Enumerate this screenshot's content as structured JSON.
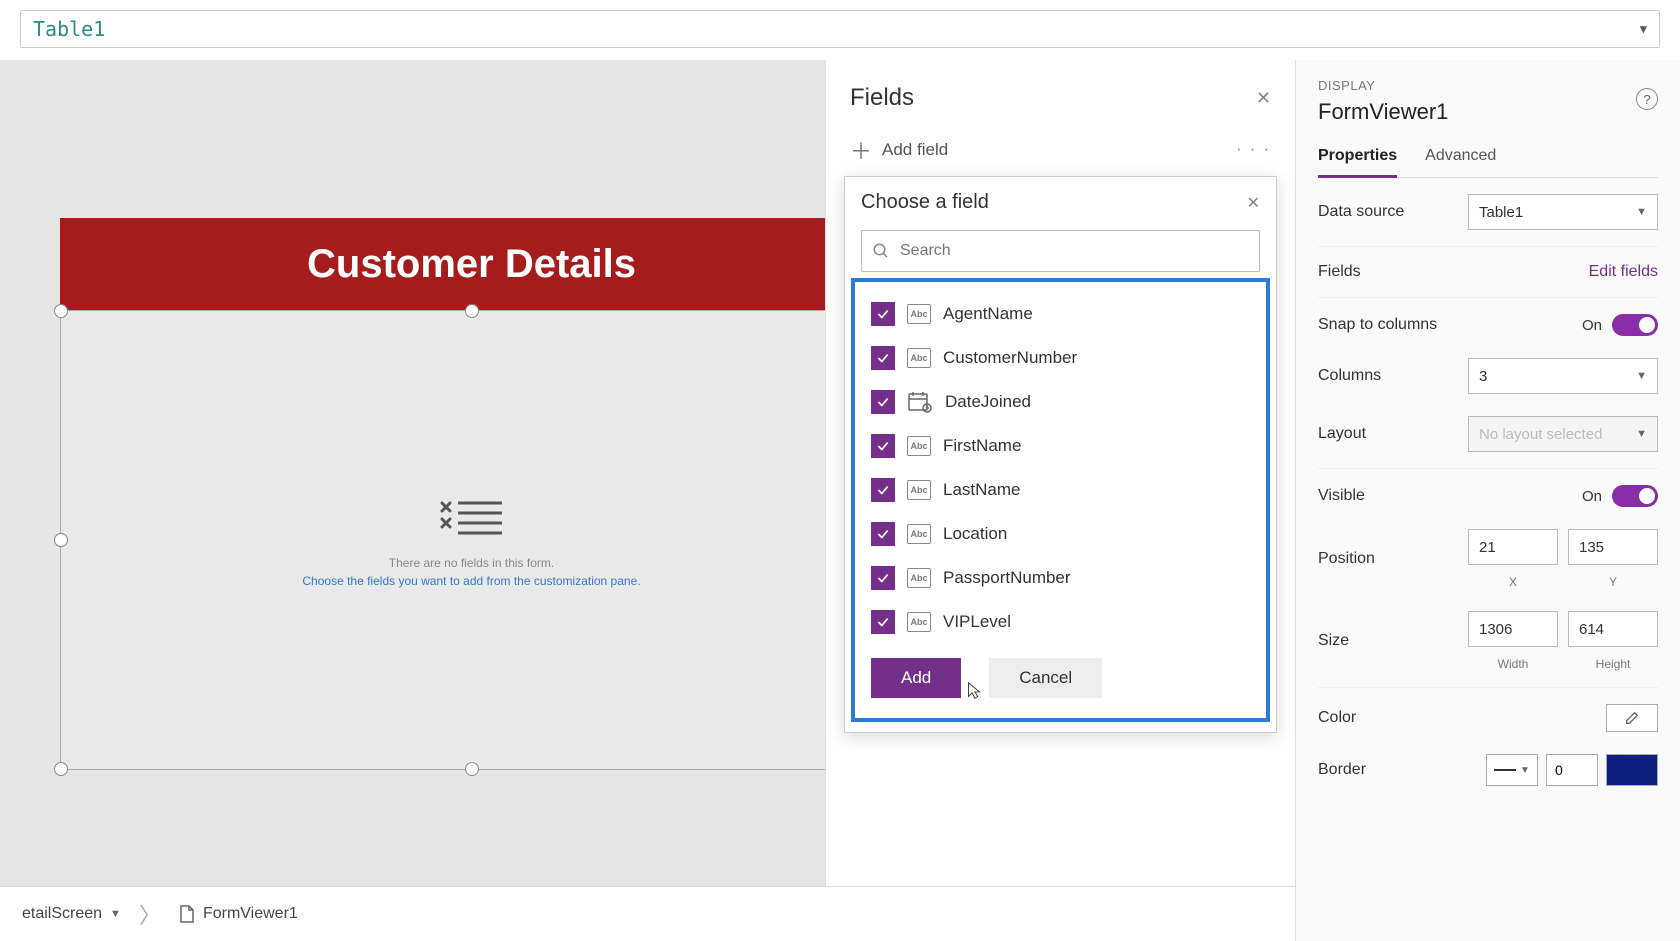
{
  "formula": {
    "text": "Table1"
  },
  "canvas": {
    "headerTitle": "Customer Details",
    "emptyMsg1": "There are no fields in this form.",
    "emptyMsg2": "Choose the fields you want to add from the customization pane."
  },
  "fieldsPanel": {
    "title": "Fields",
    "addField": "Add field",
    "choose": {
      "title": "Choose a field",
      "searchPlaceholder": "Search",
      "items": [
        {
          "name": "AgentName",
          "type": "text",
          "checked": true
        },
        {
          "name": "CustomerNumber",
          "type": "text",
          "checked": true
        },
        {
          "name": "DateJoined",
          "type": "date",
          "checked": true
        },
        {
          "name": "FirstName",
          "type": "text",
          "checked": true
        },
        {
          "name": "LastName",
          "type": "text",
          "checked": true
        },
        {
          "name": "Location",
          "type": "text",
          "checked": true
        },
        {
          "name": "PassportNumber",
          "type": "text",
          "checked": true
        },
        {
          "name": "VIPLevel",
          "type": "text",
          "checked": true
        }
      ],
      "addBtn": "Add",
      "cancelBtn": "Cancel"
    }
  },
  "props": {
    "section": "DISPLAY",
    "objName": "FormViewer1",
    "tabs": {
      "properties": "Properties",
      "advanced": "Advanced"
    },
    "dataSource": {
      "label": "Data source",
      "value": "Table1"
    },
    "fields": {
      "label": "Fields",
      "link": "Edit fields"
    },
    "snap": {
      "label": "Snap to columns",
      "value": "On"
    },
    "columns": {
      "label": "Columns",
      "value": "3"
    },
    "layout": {
      "label": "Layout",
      "placeholder": "No layout selected"
    },
    "visible": {
      "label": "Visible",
      "value": "On"
    },
    "position": {
      "label": "Position",
      "x": "21",
      "y": "135",
      "xl": "X",
      "yl": "Y"
    },
    "size": {
      "label": "Size",
      "w": "1306",
      "h": "614",
      "wl": "Width",
      "hl": "Height"
    },
    "color": {
      "label": "Color"
    },
    "border": {
      "label": "Border",
      "value": "0"
    }
  },
  "breadcrumb": {
    "first": "etailScreen",
    "second": "FormViewer1"
  }
}
